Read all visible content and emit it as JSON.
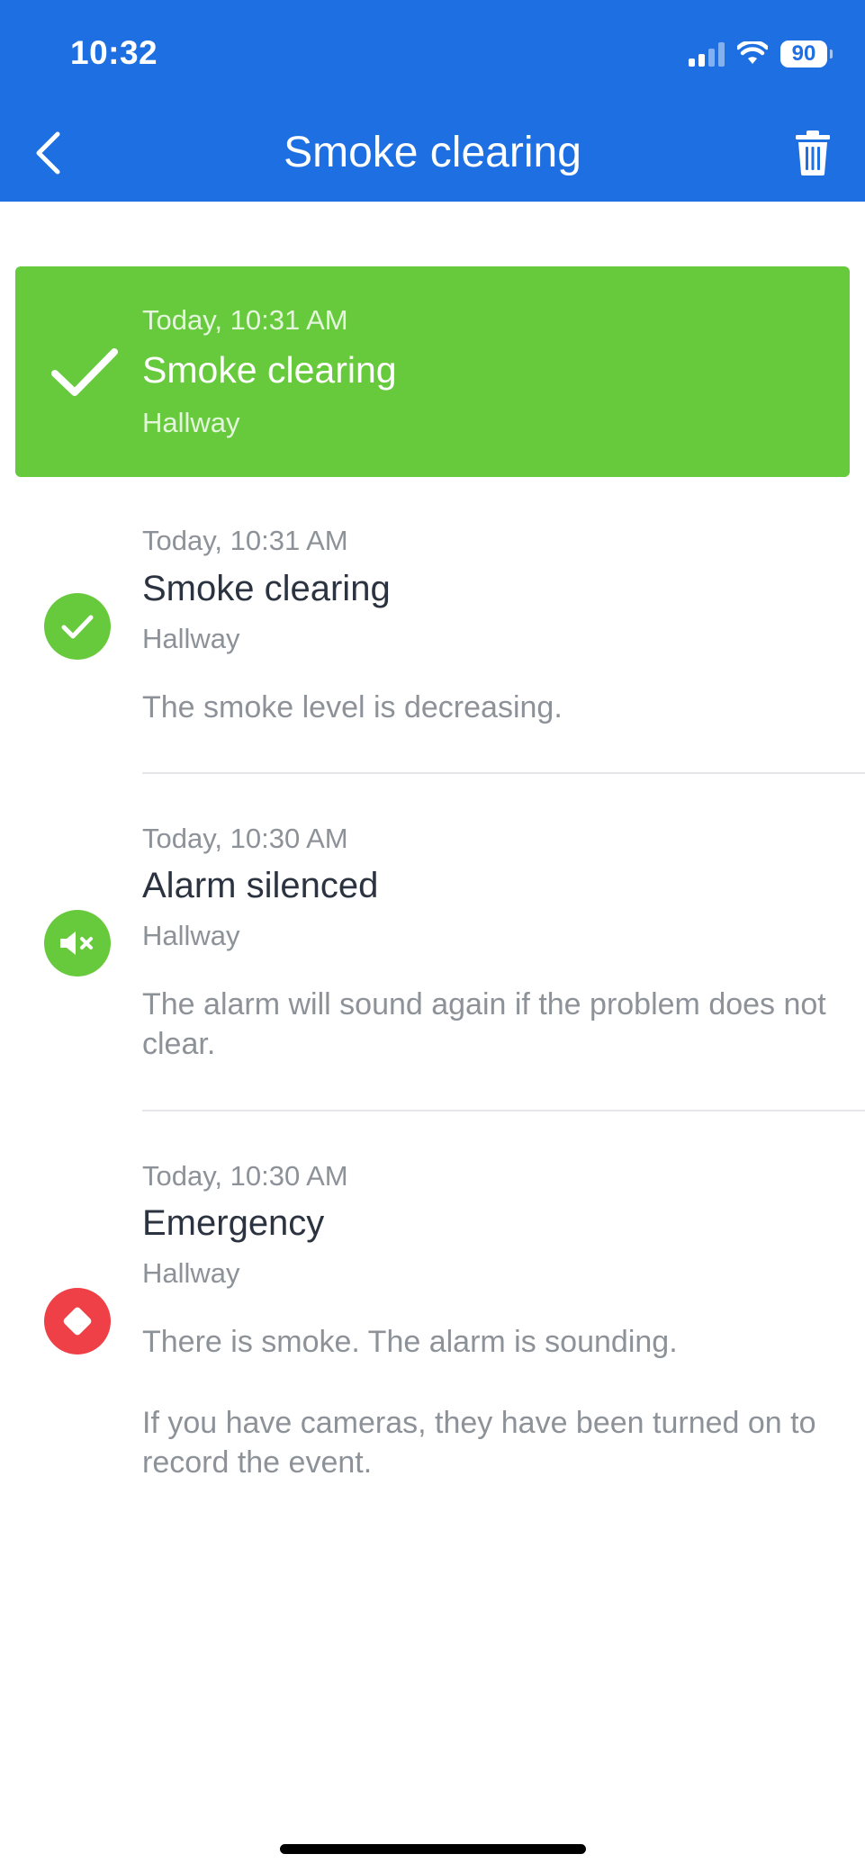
{
  "status_bar": {
    "time": "10:32",
    "battery": "90"
  },
  "nav": {
    "title": "Smoke clearing"
  },
  "active_event": {
    "time": "Today, 10:31 AM",
    "title": "Smoke clearing",
    "location": "Hallway"
  },
  "events": [
    {
      "time": "Today, 10:31 AM",
      "title": "Smoke clearing",
      "location": "Hallway",
      "description": "The smoke level is decreasing.",
      "icon": "check-circle-icon",
      "color": "#67CA3C"
    },
    {
      "time": "Today, 10:30 AM",
      "title": "Alarm silenced",
      "location": "Hallway",
      "description": "The alarm will sound again if the problem does not clear.",
      "icon": "speaker-muted-icon",
      "color": "#67CA3C"
    },
    {
      "time": "Today, 10:30 AM",
      "title": "Emergency",
      "location": "Hallway",
      "description": "There is smoke. The alarm is sounding.",
      "description_2": "If you have cameras, they have been turned on to record the event.",
      "icon": "emergency-diamond-icon",
      "color": "#EF4048"
    }
  ],
  "colors": {
    "header": "#1E6FE2",
    "active_card": "#67CA3C",
    "success": "#67CA3C",
    "danger": "#EF4048"
  }
}
